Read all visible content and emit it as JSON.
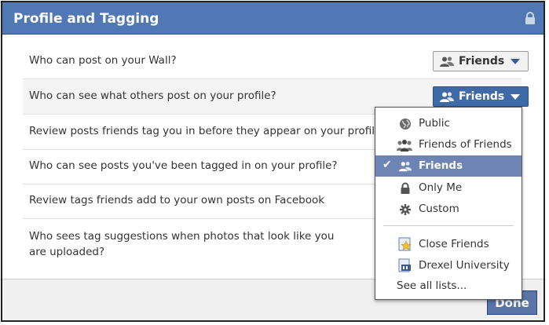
{
  "dialog": {
    "title": "Profile and Tagging",
    "lock_icon": "lock-icon"
  },
  "settings": [
    {
      "label": "Who can post on your Wall?",
      "button": "Friends"
    },
    {
      "label": "Who can see what others post on your profile?",
      "button": "Friends"
    },
    {
      "label": "Review posts friends tag you in before they appear on your profile"
    },
    {
      "label": "Who can see posts you've been tagged in on your profile?"
    },
    {
      "label": "Review tags friends add to your own posts on Facebook"
    },
    {
      "label": "Who sees tag suggestions when photos that look like you are uploaded?"
    }
  ],
  "menu": {
    "items": [
      {
        "label": "Public",
        "icon": "globe-icon"
      },
      {
        "label": "Friends of Friends",
        "icon": "friends-of-friends-icon"
      },
      {
        "label": "Friends",
        "icon": "friends-icon",
        "selected": true
      },
      {
        "label": "Only Me",
        "icon": "lock-icon"
      },
      {
        "label": "Custom",
        "icon": "gear-icon"
      }
    ],
    "lists": [
      {
        "label": "Close Friends",
        "icon": "close-friends-star-icon"
      },
      {
        "label": "Drexel University",
        "icon": "school-network-icon"
      }
    ],
    "see_all": "See all lists..."
  },
  "footer": {
    "done_label": "Done"
  },
  "colors": {
    "header": "#5078b4",
    "selected": "#6d84b4",
    "active_button": "#3e6aa8"
  }
}
